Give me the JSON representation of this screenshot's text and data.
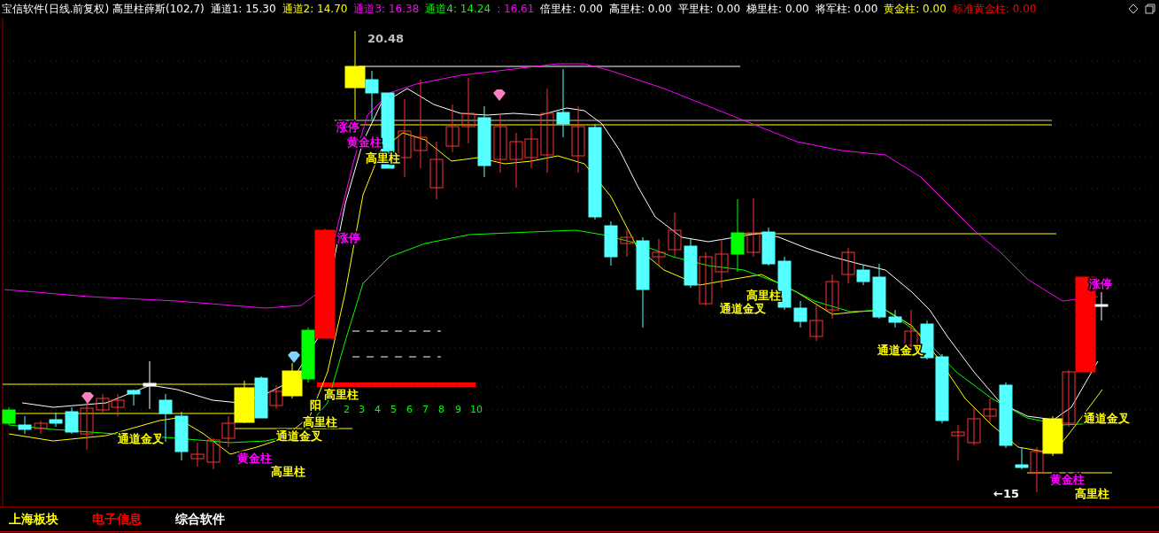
{
  "header": {
    "title": "宝信软件(日线.前复权) 高里柱薛斯(102,7)",
    "legend": [
      {
        "text": "通道1: 15.30",
        "color": "#ffffff"
      },
      {
        "text": "通道2: 14.70",
        "color": "#ffff00"
      },
      {
        "text": "通道3: 16.38",
        "color": "#ff00ff"
      },
      {
        "text": "通道4: 14.24",
        "color": "#00ff00"
      },
      {
        "text": ": 16.61",
        "color": "#ff00ff"
      },
      {
        "text": "倍里柱: 0.00",
        "color": "#ffffff"
      },
      {
        "text": "高里柱: 0.00",
        "color": "#ffffff"
      },
      {
        "text": "平里柱: 0.00",
        "color": "#ffffff"
      },
      {
        "text": "梯里柱: 0.00",
        "color": "#ffffff"
      },
      {
        "text": "将军柱: 0.00",
        "color": "#ffffff"
      },
      {
        "text": "黄金柱: 0.00",
        "color": "#ffff00"
      },
      {
        "text": "标准黄金柱: 0.00",
        "color": "#ff0000"
      }
    ]
  },
  "chart": {
    "annotations": [
      {
        "text": "20.48",
        "color": "#c0c0c0"
      },
      {
        "text": "涨停",
        "color": "#ff00ff"
      },
      {
        "text": "黄金柱",
        "color": "#ff00ff"
      },
      {
        "text": "高里柱",
        "color": "#ffff00"
      },
      {
        "text": "涨停",
        "color": "#ff00ff"
      },
      {
        "text": "高里柱",
        "color": "#ffff00"
      },
      {
        "text": "通道金叉",
        "color": "#ffff00"
      },
      {
        "text": "涨停",
        "color": "#ff00ff"
      },
      {
        "text": "通道金叉",
        "color": "#ffff00"
      },
      {
        "text": "通道金叉",
        "color": "#ffff00"
      },
      {
        "text": "阳",
        "color": "#ffff00"
      },
      {
        "text": "高里柱",
        "color": "#ffff00"
      },
      {
        "text": "高里柱",
        "color": "#ffff00"
      },
      {
        "text": "通道金叉",
        "color": "#ffff00"
      },
      {
        "text": "通道金叉",
        "color": "#ffff00"
      },
      {
        "text": "黄金柱",
        "color": "#ff00ff"
      },
      {
        "text": "高里柱",
        "color": "#ffff00"
      },
      {
        "text": "黄金柱",
        "color": "#ff00ff"
      },
      {
        "text": "←15",
        "color": "#ffffff"
      },
      {
        "text": "高里柱",
        "color": "#ffff00"
      }
    ],
    "day_counts": [
      "2",
      "3",
      "4",
      "5",
      "6",
      "7",
      "8",
      "9",
      "10"
    ]
  },
  "footer": [
    {
      "text": "上海板块",
      "color": "#ffff00"
    },
    {
      "text": "电子信息",
      "color": "#ff0000"
    },
    {
      "text": "综合软件",
      "color": "#ffffff"
    }
  ]
}
